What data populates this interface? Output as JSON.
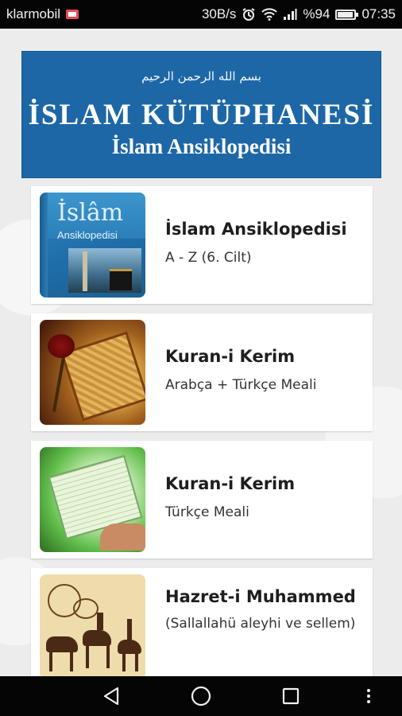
{
  "status_bar": {
    "carrier": "klarmobil",
    "net_speed": "30B/s",
    "battery_percent": "%94",
    "battery_level": 0.94,
    "time": "07:35",
    "icons": [
      "carrier-badge-icon",
      "alarm-icon",
      "wifi-icon",
      "signal-icon",
      "battery-icon"
    ]
  },
  "banner": {
    "bismillah": "بسم الله الرحمن الرحيم",
    "title": "İSLAM KÜTÜPHANESİ",
    "subtitle": "İslam Ansiklopedisi",
    "color": "#1d67a6"
  },
  "items": [
    {
      "title": "İslam Ansiklopedisi",
      "subtitle": "A - Z (6. Cilt)",
      "cover_title": "İslâm",
      "cover_subtitle": "Ansiklopedisi"
    },
    {
      "title": "Kuran-i Kerim",
      "subtitle": "Arabça + Türkçe Meali"
    },
    {
      "title": "Kuran-i Kerim",
      "subtitle": "Türkçe Meali"
    },
    {
      "title": "Hazret-i Muhammed",
      "subtitle": "(Sallallahü aleyhi ve sellem)"
    }
  ],
  "nav_bar": {
    "icons": [
      "back-icon",
      "home-icon",
      "recents-icon",
      "more-icon"
    ]
  }
}
